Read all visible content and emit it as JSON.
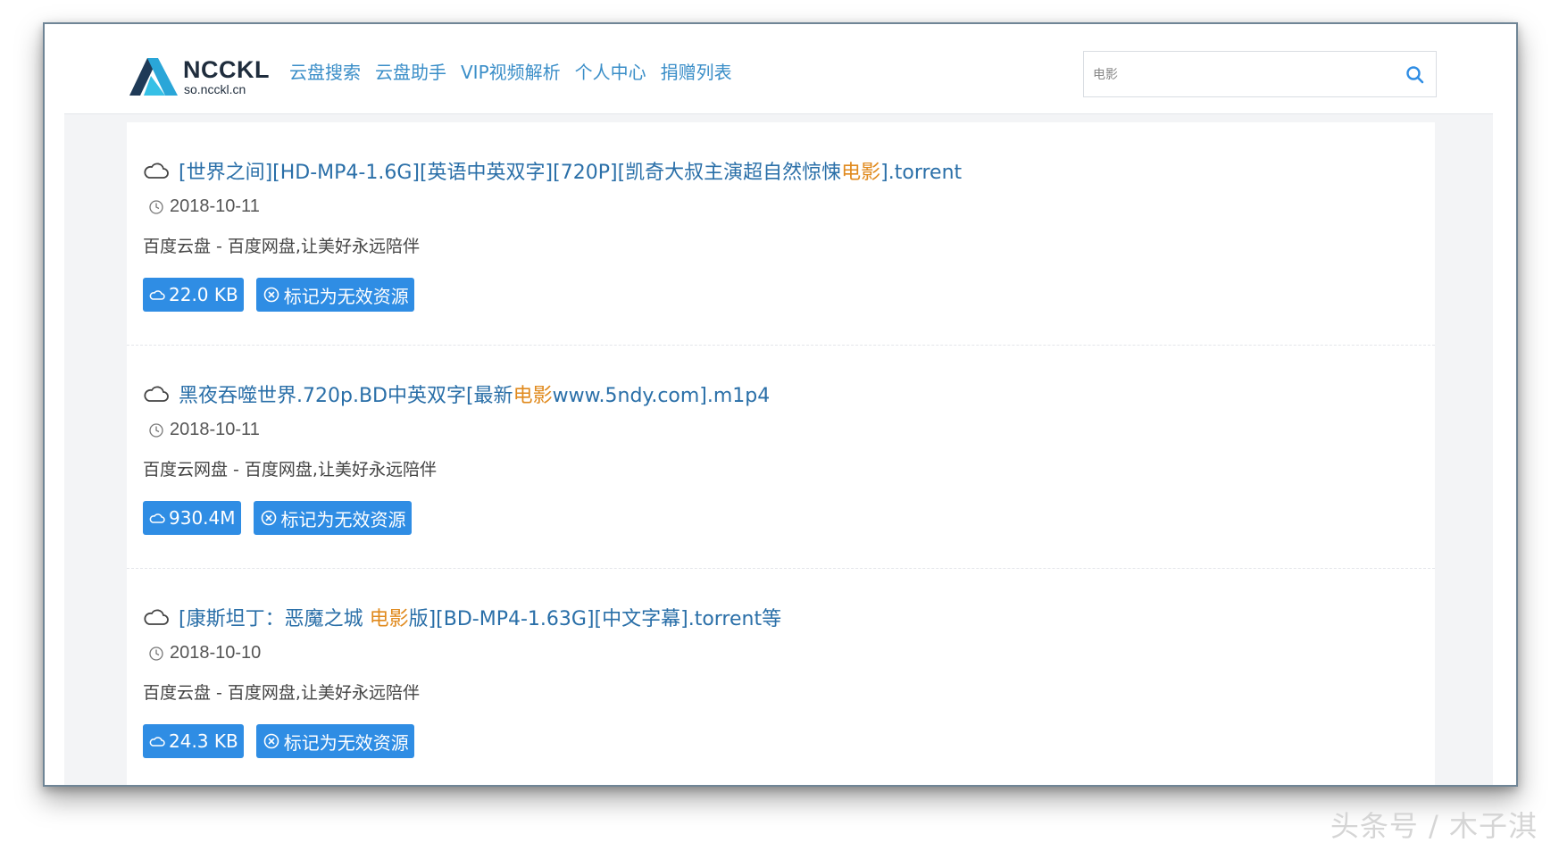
{
  "header": {
    "logo_name": "NCCKL",
    "logo_domain": "so.ncckl.cn",
    "nav": [
      "云盘搜索",
      "云盘助手",
      "VIP视频解析",
      "个人中心",
      "捐赠列表"
    ],
    "search": {
      "value": "电影"
    }
  },
  "results": [
    {
      "title_pre": "[世界之间][HD-MP4-1.6G][英语中英双字][720P][凯奇大叔主演超自然惊悚",
      "title_hl": "电影",
      "title_post": "].torrent",
      "date": "2018-10-11",
      "desc": "百度云盘 - 百度网盘,让美好永远陪伴",
      "size": "22.0 KB",
      "mark_label": "标记为无效资源"
    },
    {
      "title_pre": "黑夜吞噬世界.720p.BD中英双字[最新",
      "title_hl": "电影",
      "title_post": "www.5ndy.com].m1p4",
      "date": "2018-10-11",
      "desc": "百度云网盘 - 百度网盘,让美好永远陪伴",
      "size": "930.4M",
      "mark_label": "标记为无效资源"
    },
    {
      "title_pre": "[康斯坦丁：恶魔之城 ",
      "title_hl": "电影",
      "title_post": "版][BD-MP4-1.63G][中文字幕].torrent等",
      "date": "2018-10-10",
      "desc": "百度云盘 - 百度网盘,让美好永远陪伴",
      "size": "24.3 KB",
      "mark_label": "标记为无效资源"
    }
  ],
  "watermark": "头条号 / 木子淇",
  "colors": {
    "link": "#3a8ec8",
    "title": "#2a6fa8",
    "highlight": "#e08a1e",
    "button": "#2f8de4"
  }
}
